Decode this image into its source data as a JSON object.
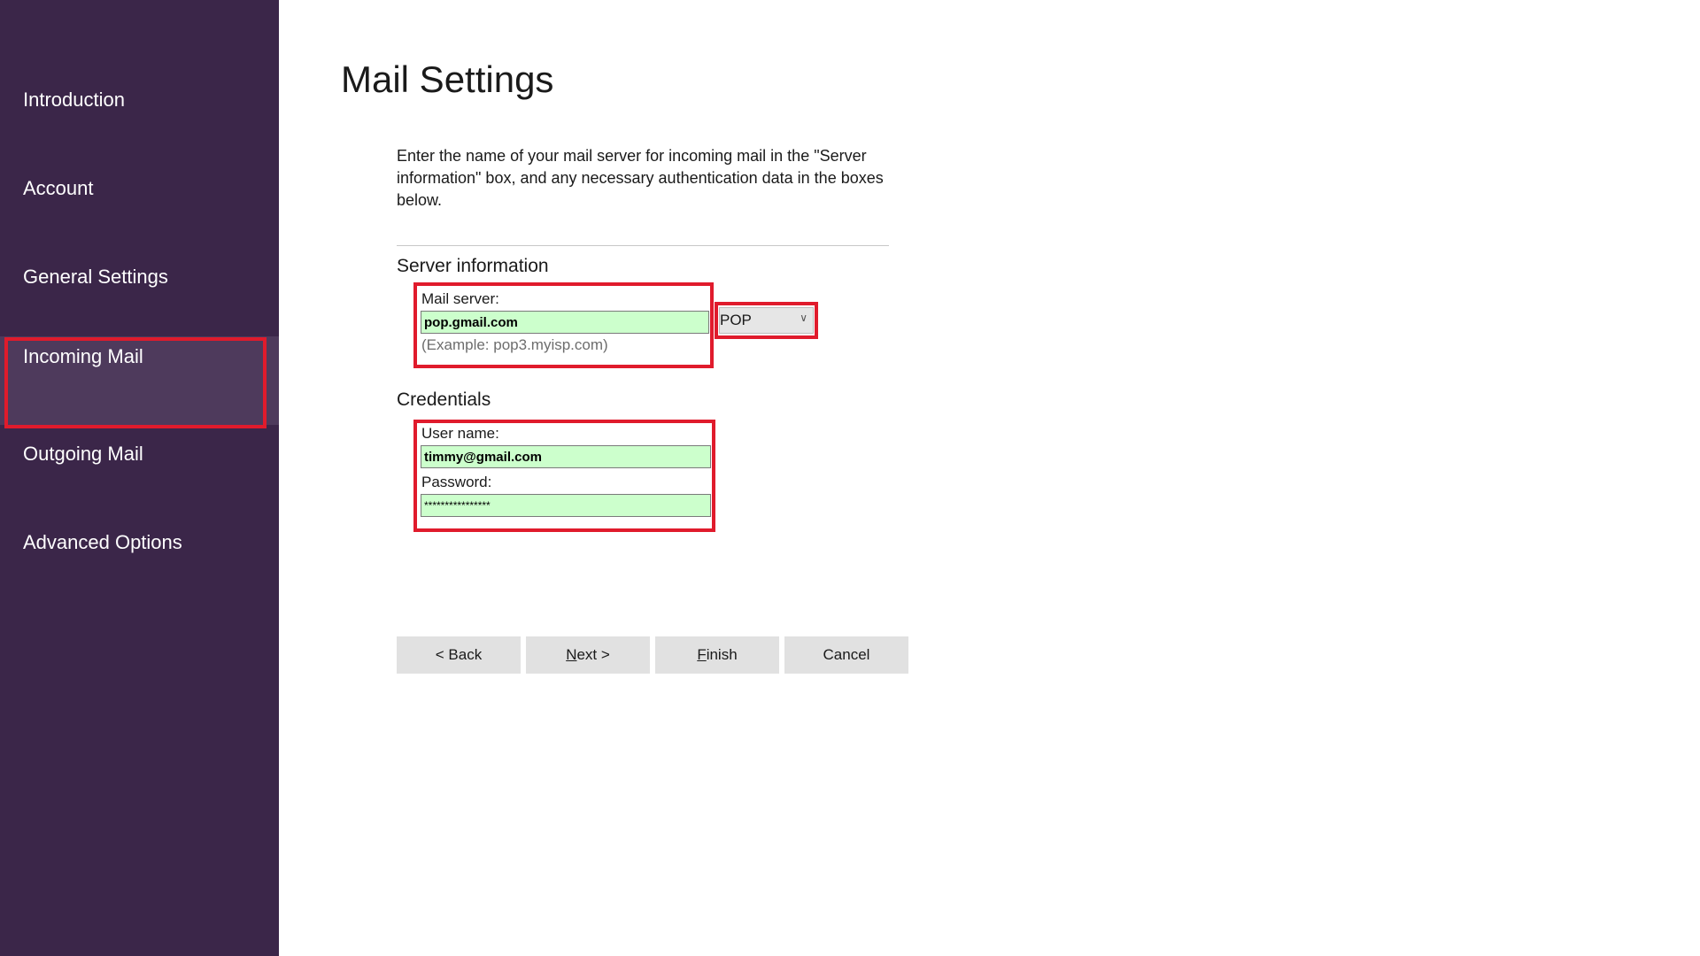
{
  "sidebar": {
    "items": [
      {
        "label": "Introduction"
      },
      {
        "label": "Account"
      },
      {
        "label": "General Settings"
      },
      {
        "label": "Incoming Mail",
        "active": true
      },
      {
        "label": "Outgoing Mail"
      },
      {
        "label": "Advanced Options"
      }
    ]
  },
  "main": {
    "title": "Mail Settings",
    "intro": "Enter the name of your mail server for incoming mail in the \"Server information\" box, and any necessary authentication data in the boxes below.",
    "server_section": {
      "heading": "Server information",
      "mail_server_label": "Mail server:",
      "mail_server_value": "pop.gmail.com",
      "mail_server_hint": "(Example: pop3.myisp.com)",
      "protocol_selected": "POP"
    },
    "credentials_section": {
      "heading": "Credentials",
      "username_label": "User name:",
      "username_value": "timmy@gmail.com",
      "password_label": "Password:",
      "password_value": "****************"
    }
  },
  "buttons": {
    "back": "< Back",
    "next_mnemonic": "N",
    "next_rest": "ext >",
    "finish_mnemonic": "F",
    "finish_rest": "inish",
    "cancel": "Cancel"
  },
  "colors": {
    "sidebar_bg": "#3b2649",
    "highlight": "#e01b2c",
    "input_fill": "#ccffcc"
  }
}
